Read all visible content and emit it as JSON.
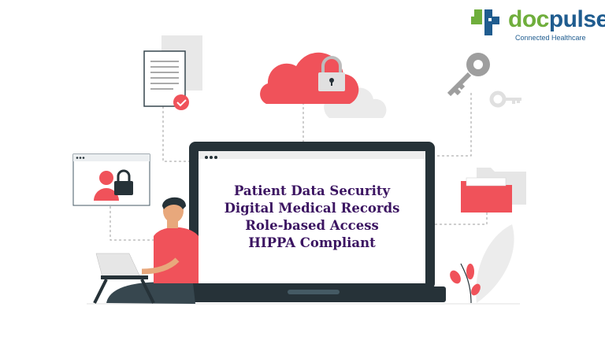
{
  "brand": {
    "name_part1": "doc",
    "name_part2": "pulse",
    "tagline": "Connected Healthcare"
  },
  "screen": {
    "lines": [
      "Patient Data Security",
      "Digital Medical Records",
      "Role-based Access",
      "HIPPA Compliant"
    ]
  },
  "colors": {
    "accent_red": "#f0525a",
    "laptop_frame": "#263238",
    "text_purple": "#3b1461",
    "logo_green": "#6fae3c",
    "logo_blue": "#1f5c8f"
  }
}
